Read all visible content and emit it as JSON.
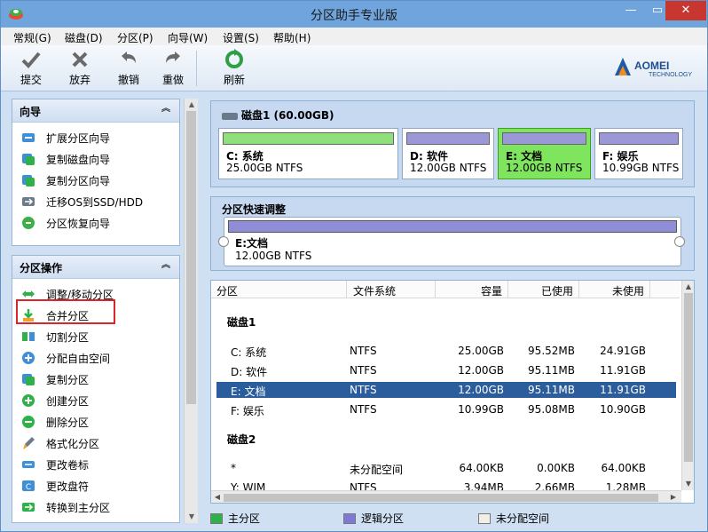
{
  "window": {
    "title": "分区助手专业版",
    "min": "—",
    "max": "▭",
    "close": "✕"
  },
  "menu": [
    "常规(G)",
    "磁盘(D)",
    "分区(P)",
    "向导(W)",
    "设置(S)",
    "帮助(H)"
  ],
  "toolbar": {
    "commit": "提交",
    "discard": "放弃",
    "undo": "撤销",
    "redo": "重做",
    "refresh": "刷新",
    "logo_main": "AOMEI",
    "logo_sub": "TECHNOLOGY"
  },
  "wizard": {
    "title": "向导",
    "items": [
      "扩展分区向导",
      "复制磁盘向导",
      "复制分区向导",
      "迁移OS到SSD/HDD",
      "分区恢复向导"
    ]
  },
  "ops": {
    "title": "分区操作",
    "items": [
      "调整/移动分区",
      "合并分区",
      "切割分区",
      "分配自由空间",
      "复制分区",
      "创建分区",
      "删除分区",
      "格式化分区",
      "更改卷标",
      "更改盘符",
      "转换到主分区"
    ]
  },
  "disk1": {
    "title": "磁盘1 (60.00GB)",
    "partitions": [
      {
        "name": "C: 系统",
        "size": "25.00GB NTFS",
        "color": "#8fe07a",
        "selected": false
      },
      {
        "name": "D: 软件",
        "size": "12.00GB NTFS",
        "color": "#9b98d8",
        "selected": false
      },
      {
        "name": "E: 文档",
        "size": "12.00GB NTFS",
        "color": "#9b98d8",
        "selected": true
      },
      {
        "name": "F: 娱乐",
        "size": "10.99GB NTFS",
        "color": "#9b98d8",
        "selected": false
      }
    ]
  },
  "quick": {
    "title": "分区快速调整",
    "name": "E:文档",
    "size": "12.00GB NTFS"
  },
  "table": {
    "headers": [
      "分区",
      "文件系统",
      "容量",
      "已使用",
      "未使用"
    ],
    "groups": [
      {
        "name": "磁盘1",
        "rows": [
          [
            "C: 系统",
            "NTFS",
            "25.00GB",
            "95.52MB",
            "24.91GB"
          ],
          [
            "D: 软件",
            "NTFS",
            "12.00GB",
            "95.11MB",
            "11.91GB"
          ],
          [
            "E: 文档",
            "NTFS",
            "12.00GB",
            "95.11MB",
            "11.91GB"
          ],
          [
            "F: 娱乐",
            "NTFS",
            "10.99GB",
            "95.08MB",
            "10.90GB"
          ]
        ]
      },
      {
        "name": "磁盘2",
        "rows": [
          [
            "*",
            "未分配空间",
            "64.00KB",
            "0.00KB",
            "64.00KB"
          ],
          [
            "Y: WIM",
            "NTFS",
            "3.94MB",
            "2.66MB",
            "1.28MB"
          ]
        ]
      }
    ]
  },
  "legend": {
    "primary": "主分区",
    "logical": "逻辑分区",
    "unallocated": "未分配空间"
  }
}
